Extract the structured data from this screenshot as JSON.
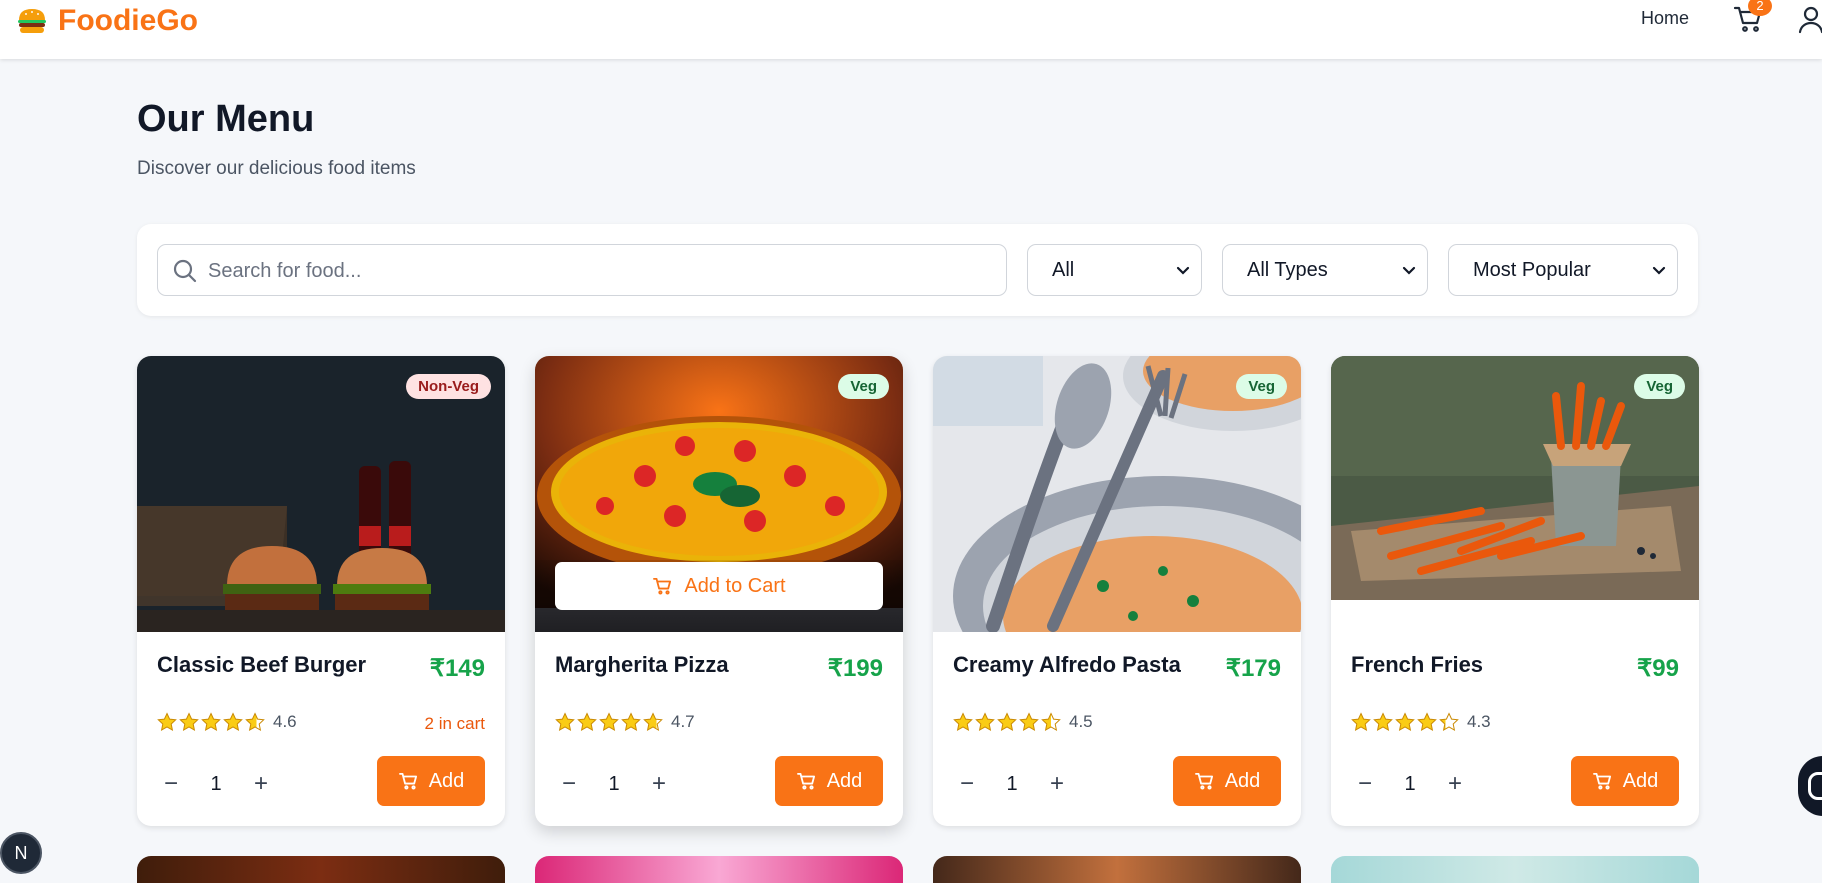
{
  "header": {
    "brand": "FoodieGo",
    "nav_home": "Home",
    "cart_count": "2"
  },
  "page": {
    "title": "Our Menu",
    "subtitle": "Discover our delicious food items"
  },
  "filters": {
    "search_placeholder": "Search for food...",
    "category_selected": "All",
    "type_selected": "All Types",
    "sort_selected": "Most Popular"
  },
  "items": [
    {
      "name": "Classic Beef Burger",
      "price": "₹149",
      "badge": "Non-Veg",
      "rating": "4.6",
      "rating_value": 4.6,
      "in_cart": "2 in cart",
      "qty": "1",
      "add_label": "Add"
    },
    {
      "name": "Margherita Pizza",
      "price": "₹199",
      "badge": "Veg",
      "rating": "4.7",
      "rating_value": 4.7,
      "qty": "1",
      "add_label": "Add",
      "overlay_label": "Add to Cart"
    },
    {
      "name": "Creamy Alfredo Pasta",
      "price": "₹179",
      "badge": "Veg",
      "rating": "4.5",
      "rating_value": 4.5,
      "qty": "1",
      "add_label": "Add"
    },
    {
      "name": "French Fries",
      "price": "₹99",
      "badge": "Veg",
      "rating": "4.3",
      "rating_value": 4.3,
      "qty": "1",
      "add_label": "Add"
    }
  ],
  "dev_badge": "N",
  "colors": {
    "accent": "#f97316",
    "price": "#16a34a",
    "star": "#facc15"
  }
}
